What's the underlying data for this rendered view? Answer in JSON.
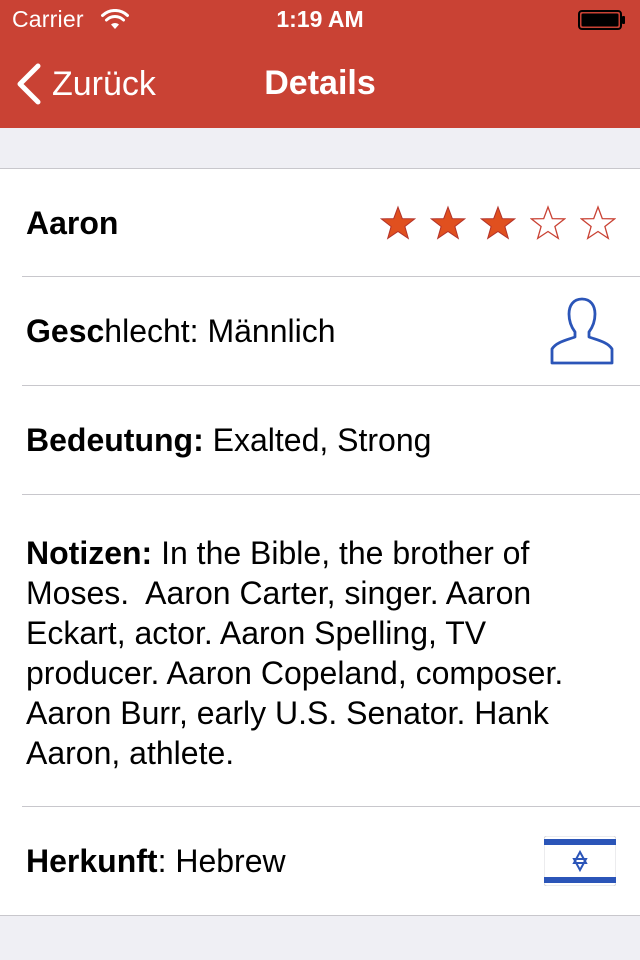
{
  "status_bar": {
    "carrier": "Carrier",
    "time": "1:19 AM",
    "wifi_icon": "wifi-icon",
    "battery_icon": "battery-icon"
  },
  "nav_bar": {
    "back_label": "Zurück",
    "back_icon": "chevron-left-icon",
    "title": "Details"
  },
  "colors": {
    "accent": "#c94234",
    "star": "#c94234",
    "star_fill": "#e0501f",
    "icon_blue": "#2b55b8",
    "separator": "#c8c7cc",
    "background": "#efeff4"
  },
  "details": {
    "name": "Aaron",
    "rating": 3,
    "rating_max": 5,
    "gender_label": "Geschlecht",
    "gender_label_bold": "Gesc",
    "gender_label_rest": "hlecht",
    "gender_value": "Männlich",
    "gender_icon": "person-icon",
    "meaning_label": "Bedeutung:",
    "meaning_value": "Exalted, Strong",
    "notes_label": "Notizen:",
    "notes_value": "In the Bible, the brother of Moses.  Aaron Carter, singer. Aaron Eckart, actor. Aaron Spelling, TV producer. Aaron Copeland, composer. Aaron Burr, early U.S. Senator. Hank Aaron, athlete.",
    "origin_label": "Herkunft",
    "origin_value": "Hebrew",
    "origin_icon": "israel-flag-icon"
  }
}
